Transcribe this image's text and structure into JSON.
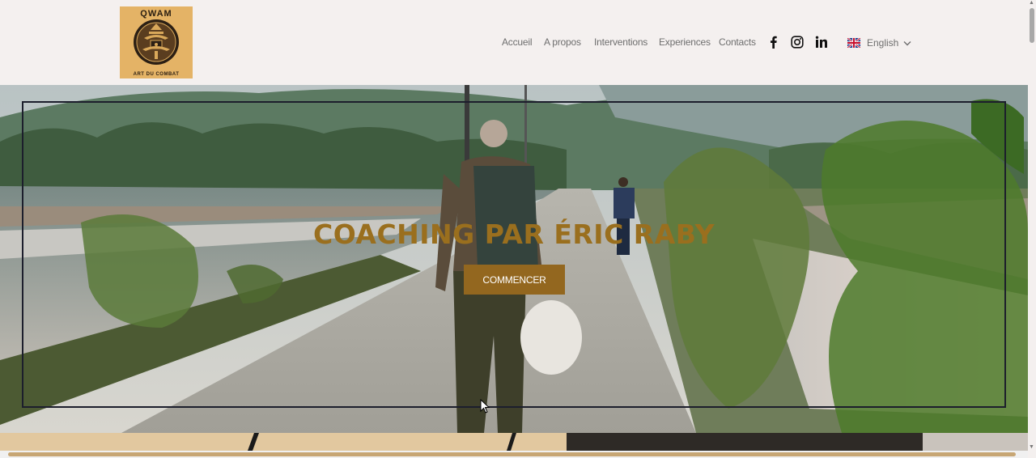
{
  "logo": {
    "top_text": "QWAM",
    "bottom_text": "ART DU COMBAT"
  },
  "nav": {
    "links": [
      "Accueil",
      "A propos",
      "Interventions",
      "Experiences",
      "Contacts"
    ]
  },
  "social": {
    "facebook_icon": "facebook-icon",
    "instagram_icon": "instagram-icon",
    "linkedin_icon": "linkedin-icon"
  },
  "language": {
    "label": "English",
    "flag_icon": "uk-flag-icon"
  },
  "hero": {
    "title": "COACHING PAR ÉRIC RABY",
    "button_label": "COMMENCER"
  },
  "colors": {
    "accent": "#93671f",
    "title": "#9a6f1e",
    "header_bg": "#f4f0ef",
    "logo_bg": "#e4b366",
    "frame": "#1c1e2c"
  }
}
